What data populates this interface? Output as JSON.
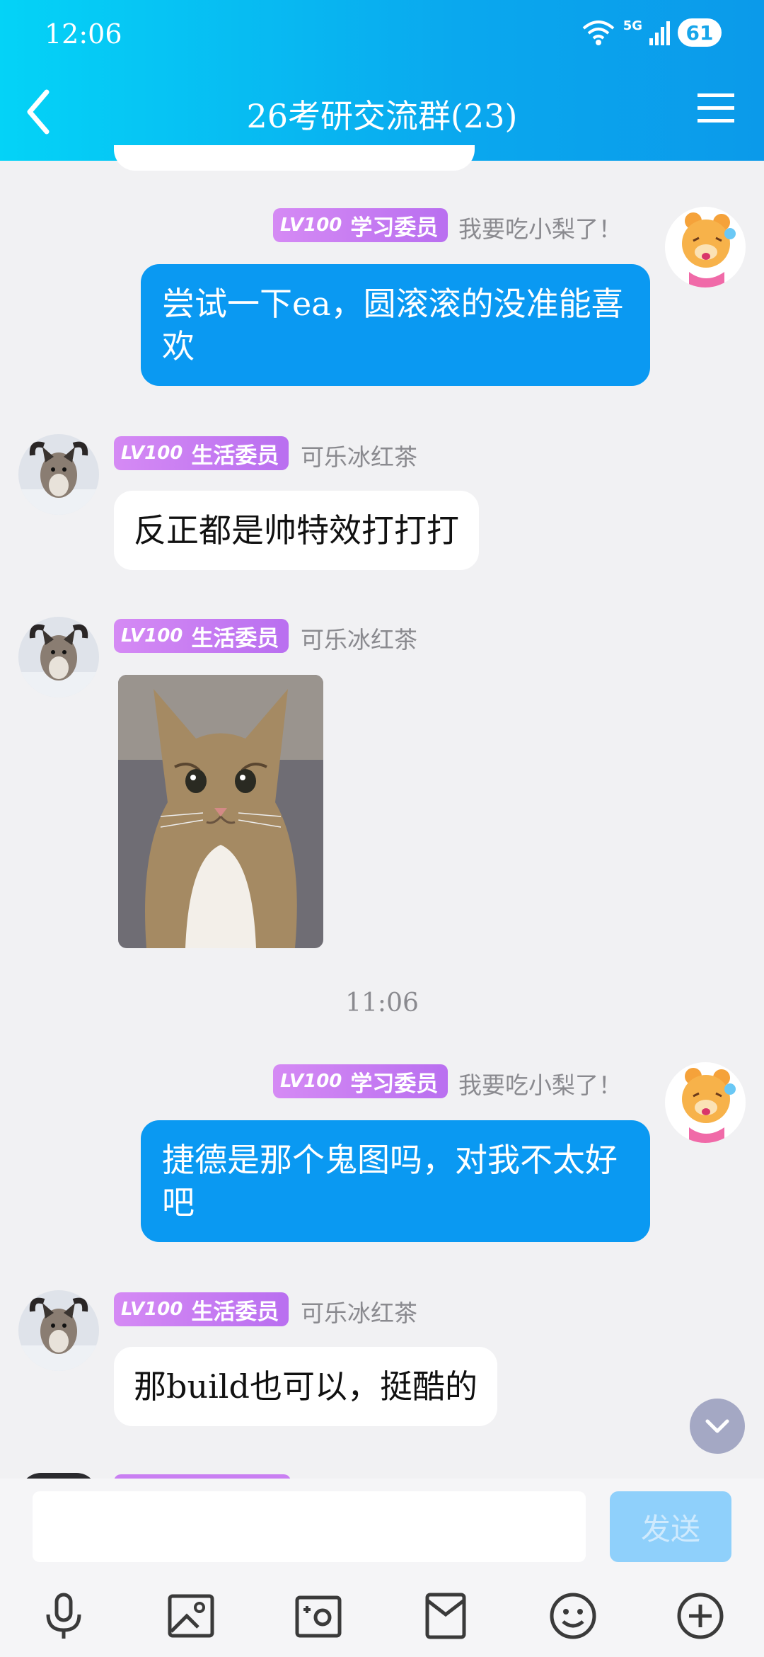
{
  "status_bar": {
    "time": "12:06",
    "network": "5G",
    "battery": "61"
  },
  "header": {
    "title": "26考研交流群(23)"
  },
  "messages": [
    {
      "side": "out",
      "level": "LV100",
      "role": "学习委员",
      "nickname": "我要吃小梨了！",
      "text": "尝试一下ea，圆滚滚的没准能喜欢"
    },
    {
      "side": "in",
      "level": "LV100",
      "role": "生活委员",
      "nickname": "可乐冰红茶",
      "text": "反正都是帅特效打打打"
    },
    {
      "side": "in",
      "level": "LV100",
      "role": "生活委员",
      "nickname": "可乐冰红茶",
      "image": "cat-photo"
    },
    {
      "side": "out",
      "level": "LV100",
      "role": "学习委员",
      "nickname": "我要吃小梨了！",
      "text": "捷德是那个鬼图吗，对我不太好吧"
    },
    {
      "side": "in",
      "level": "LV100",
      "role": "生活委员",
      "nickname": "可乐冰红茶",
      "text": "那build也可以，挺酷的"
    }
  ],
  "time_divider": "11:06",
  "input": {
    "value": "",
    "send_label": "发送"
  },
  "toolbar": {
    "icons": [
      "microphone-icon",
      "gallery-icon",
      "camera-icon",
      "red-packet-icon",
      "emoji-icon",
      "plus-icon"
    ]
  },
  "colors": {
    "header_gradient_start": "#04d3f7",
    "header_gradient_end": "#0b9aea",
    "outgoing_bubble": "#0a99f2",
    "badge": "#c97ff2",
    "send_button_disabled": "#8fd0fb"
  }
}
